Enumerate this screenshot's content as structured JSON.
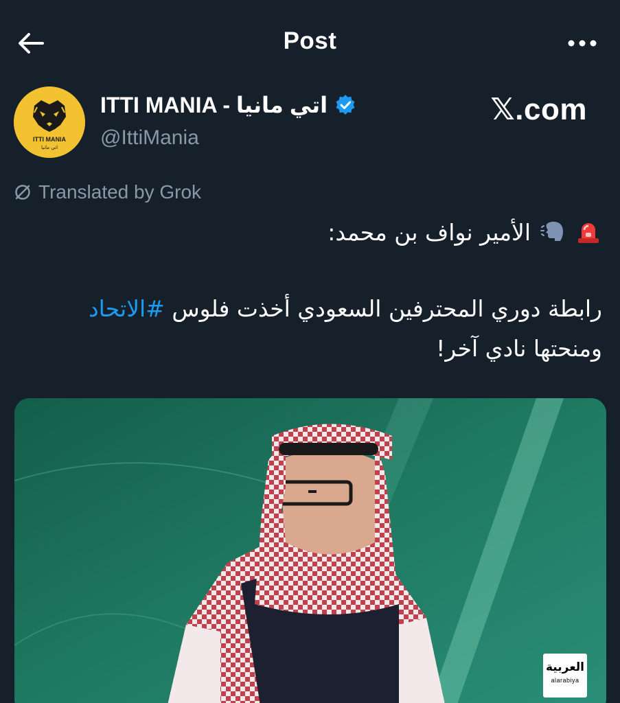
{
  "header": {
    "title": "Post",
    "back_icon": "arrow-left-icon",
    "more_icon": "more-horizontal-icon"
  },
  "author": {
    "name": "ITTI MANIA - اتي مانيا",
    "handle": "@IttiMania",
    "verified": true,
    "verified_color": "#1d9bf0",
    "avatar_text": "ITTI MANIA",
    "avatar_subtext": "اتي مانيا",
    "avatar_color": "#f2c230"
  },
  "watermark": "𝕏.com",
  "translation": {
    "label": "Translated by Grok",
    "icon": "no-translate-icon"
  },
  "post": {
    "line1_text": "الأمير نواف بن محمد:",
    "line1_emojis": [
      "rotating-light-icon",
      "speaking-head-icon"
    ],
    "line2_text": "رابطة دوري المحترفين السعودي أخذت فلوس ",
    "hashtag": "#الاتحاد",
    "line3_text": "ومنحتها نادي آخر!",
    "hashtag_color": "#1d9bf0"
  },
  "media": {
    "channel_logo_ar": "العربية",
    "channel_logo_en": "alarabiya"
  },
  "colors": {
    "background": "#15202b",
    "text_primary": "#ffffff",
    "text_secondary": "#8b98a5",
    "accent": "#1d9bf0"
  }
}
